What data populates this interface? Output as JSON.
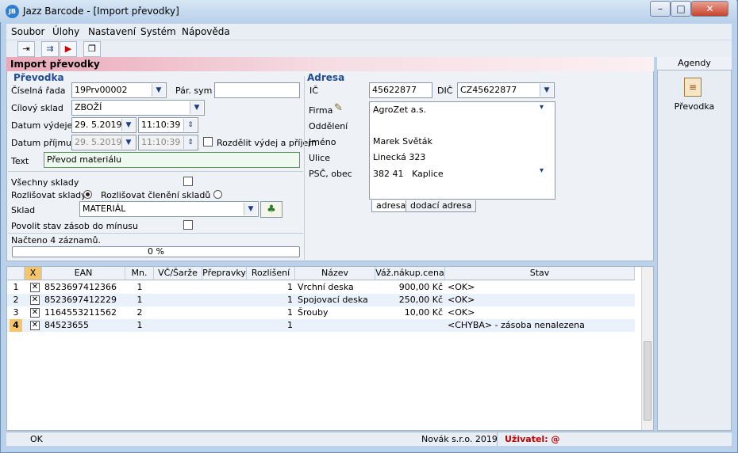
{
  "window": {
    "title": "Jazz Barcode - [Import převodky]",
    "app_icon": "JB"
  },
  "menu": [
    "Soubor",
    "Úlohy",
    "Nastavení",
    "Systém",
    "Nápověda"
  ],
  "toolbar": [
    "exit-icon",
    "transfer-icon",
    "import-icon",
    "copy-icon"
  ],
  "form": {
    "header": "Import převodky",
    "sec_prevodka": "Převodka",
    "sec_adresa": "Adresa",
    "ciselna_rada_label": "Číselná řada",
    "ciselna_rada": "19Prv00002",
    "par_sym_label": "Pár. sym",
    "par_sym": "",
    "cilovy_sklad_label": "Cílový sklad",
    "cilovy_sklad": "ZBOŽÍ",
    "datum_vydeje_label": "Datum výdeje",
    "datum_vydeje": "29. 5.2019",
    "cas_vydeje": "11:10:39",
    "datum_prijmu_label": "Datum příjmu",
    "datum_prijmu": "29. 5.2019",
    "cas_prijmu": "11:10:39",
    "rozdelit_label": "Rozdělit výdej a příjem",
    "text_label": "Text",
    "text": "Převod materiálu",
    "vsechny_sklady": "Všechny sklady",
    "rozlisovat_sklady": "Rozlišovat sklady",
    "rozlisovat_cleneni": "Rozlišovat členění skladů",
    "sklad_label": "Sklad",
    "sklad": "MATERIÁL",
    "povolit": "Povolit stav zásob do mínusu",
    "nacteno": "Načteno 4 záznamů.",
    "progress": "0 %",
    "progress_value": 0
  },
  "adresa": {
    "ic_label": "IČ",
    "ic": "45622877",
    "dic_label": "DIČ",
    "dic": "CZ45622877",
    "firma_label": "Firma",
    "firma": "AgroZet a.s.",
    "oddeleni_label": "Oddělení",
    "oddeleni": "",
    "jmeno_label": "Jméno",
    "jmeno": "Marek Světák",
    "ulice_label": "Ulice",
    "ulice": "Linecká 323",
    "psc_label": "PSČ, obec",
    "psc": "382 41",
    "obec": "Kaplice",
    "tab1": "adresa",
    "tab2": "dodací adresa"
  },
  "agenda": {
    "header": "Agendy",
    "item": "Převodka"
  },
  "grid": {
    "columns": [
      "",
      "X",
      "EAN",
      "Mn.",
      "VČ/Šarže",
      "Přepravky",
      "Rozlišení",
      "Název",
      "Váž.nákup.cena",
      "Stav"
    ],
    "rows": [
      {
        "n": "1",
        "ean": "8523697412366",
        "mn": "1",
        "rozl": "1",
        "nazev": "Vrchní deska",
        "cena": "900,00 Kč",
        "stav": "<OK>"
      },
      {
        "n": "2",
        "ean": "8523697412229",
        "mn": "1",
        "rozl": "1",
        "nazev": "Spojovací deska",
        "cena": "250,00 Kč",
        "stav": "<OK>"
      },
      {
        "n": "3",
        "ean": "1164553211562",
        "mn": "2",
        "rozl": "1",
        "nazev": "Šrouby",
        "cena": "10,00 Kč",
        "stav": "<OK>"
      },
      {
        "n": "4",
        "ean": "84523655",
        "mn": "1",
        "rozl": "1",
        "nazev": "",
        "cena": "",
        "stav": "<CHYBA> - zásoba nenalezena"
      }
    ]
  },
  "status": {
    "left": "OK",
    "company": "Novák s.r.o. 2019",
    "user_label": "Uživatel: @"
  },
  "colors": {
    "accent": "#1f4d94",
    "error": "#c00000",
    "header_pink": "#e9a8b8"
  }
}
